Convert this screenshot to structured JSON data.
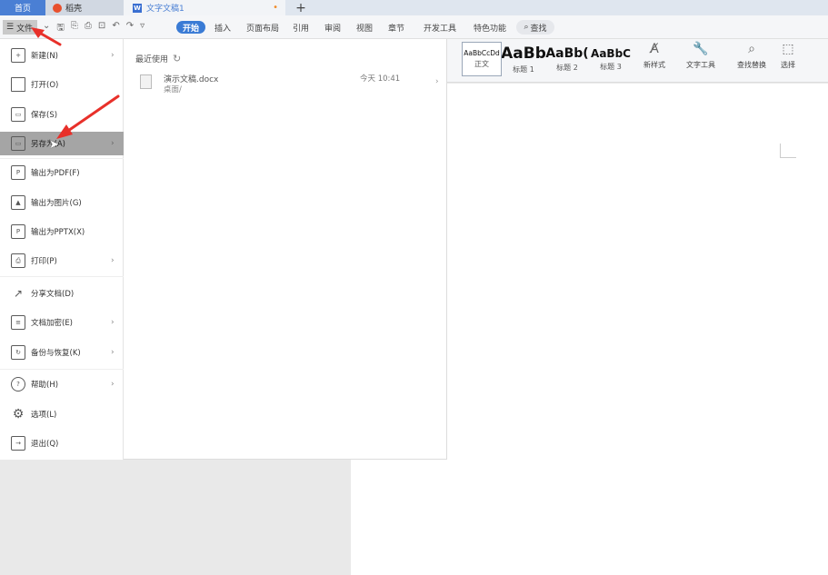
{
  "tabs": {
    "home": "首页",
    "wps": "稻壳",
    "doc": "文字文稿1",
    "doc_dot": "•",
    "add": "+"
  },
  "menubar": {
    "file": "文件",
    "items": [
      "开始",
      "插入",
      "页面布局",
      "引用",
      "审阅",
      "视图",
      "章节",
      "开发工具",
      "特色功能"
    ],
    "search": "查找"
  },
  "ribbon": {
    "styles": [
      {
        "sample": "AaBbCcDd",
        "caption": "正文"
      },
      {
        "sample": "AaBb",
        "caption": "标题 1"
      },
      {
        "sample": "AaBb(",
        "caption": "标题 2"
      },
      {
        "sample": "AaBbC",
        "caption": "标题 3"
      }
    ],
    "new_style": "新样式",
    "text_tools": "文字工具",
    "find_replace": "查找替换",
    "select": "选择"
  },
  "file_menu": {
    "items": [
      {
        "label": "新建(N)",
        "icon": "new-doc-icon",
        "arrow": true
      },
      {
        "label": "打开(O)",
        "icon": "folder-icon",
        "arrow": false
      },
      {
        "label": "保存(S)",
        "icon": "save-icon",
        "arrow": false
      },
      {
        "label": "另存为(A)",
        "icon": "save-as-icon",
        "arrow": true
      },
      {
        "label": "输出为PDF(F)",
        "icon": "pdf-icon",
        "arrow": false
      },
      {
        "label": "输出为图片(G)",
        "icon": "image-icon",
        "arrow": false
      },
      {
        "label": "输出为PPTX(X)",
        "icon": "pptx-icon",
        "arrow": false
      },
      {
        "label": "打印(P)",
        "icon": "print-icon",
        "arrow": true
      },
      {
        "label": "分享文档(D)",
        "icon": "share-icon",
        "arrow": false
      },
      {
        "label": "文档加密(E)",
        "icon": "lock-doc-icon",
        "arrow": true
      },
      {
        "label": "备份与恢复(K)",
        "icon": "backup-icon",
        "arrow": true
      },
      {
        "label": "帮助(H)",
        "icon": "help-icon",
        "arrow": true
      },
      {
        "label": "选项(L)",
        "icon": "gear-icon",
        "arrow": false
      },
      {
        "label": "退出(Q)",
        "icon": "exit-icon",
        "arrow": false
      }
    ]
  },
  "recent": {
    "title": "最近使用",
    "files": [
      {
        "name": "演示文稿.docx",
        "path": "桌面/",
        "time": "今天 10:41"
      }
    ]
  },
  "colors": {
    "accent": "#3a7bd5",
    "highlight": "#a5a5a5",
    "annotation": "#e8302a"
  }
}
